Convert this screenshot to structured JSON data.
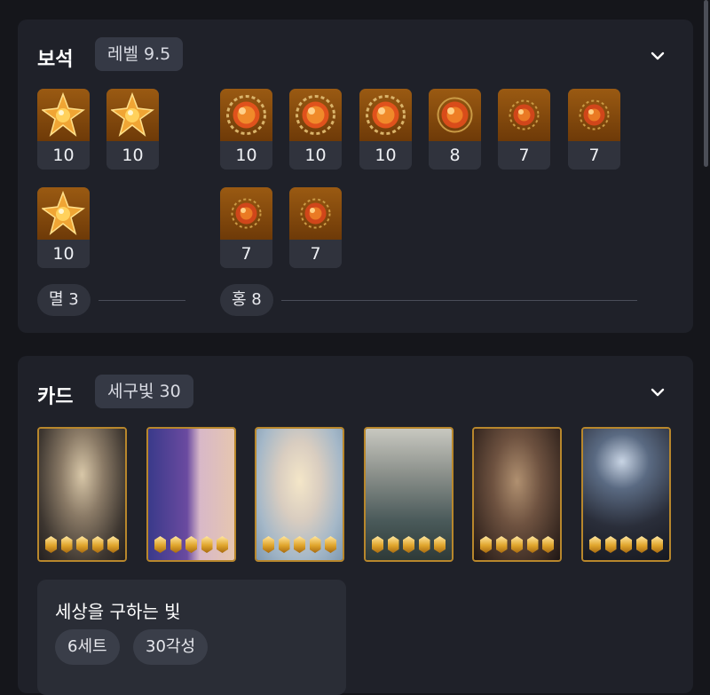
{
  "gems": {
    "title": "보석",
    "level_badge": "레벨 9.5",
    "expand_icon": "chevron-down-icon",
    "left_column": [
      {
        "type": "멸화",
        "level": "10"
      },
      {
        "type": "멸화",
        "level": "10"
      },
      {
        "type": "멸화",
        "level": "10"
      }
    ],
    "right_column": [
      {
        "type": "홍염",
        "level": "10"
      },
      {
        "type": "홍염",
        "level": "10"
      },
      {
        "type": "홍염",
        "level": "10"
      },
      {
        "type": "홍염",
        "level": "8"
      },
      {
        "type": "홍염",
        "level": "7"
      },
      {
        "type": "홍염",
        "level": "7"
      },
      {
        "type": "홍염",
        "level": "7"
      },
      {
        "type": "홍염",
        "level": "7"
      }
    ],
    "tally_left": "멸 3",
    "tally_right": "홍 8"
  },
  "cards": {
    "title": "카드",
    "set_badge": "세구빛 30",
    "expand_icon": "chevron-down-icon",
    "items": [
      {
        "awakening": 5
      },
      {
        "awakening": 5
      },
      {
        "awakening": 5
      },
      {
        "awakening": 5
      },
      {
        "awakening": 5
      },
      {
        "awakening": 5
      }
    ],
    "set_name": "세상을 구하는 빛",
    "set_count": "6세트",
    "set_awakening": "30각성"
  },
  "colors": {
    "background": "#15161b",
    "panel": "#1f2129",
    "gem_bg": "#9a5a12",
    "card_border": "#b8872c"
  }
}
